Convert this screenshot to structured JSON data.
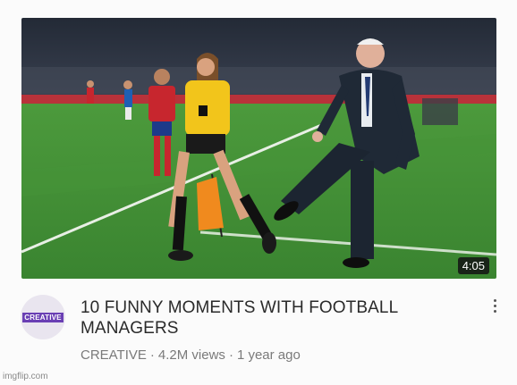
{
  "video": {
    "duration": "4:05",
    "title": "10 FUNNY MOMENTS WITH FOOTBALL MANAGERS",
    "channel": "CREATIVE",
    "views": "4.2M views",
    "separator": "·",
    "age": "1 year ago",
    "avatar_text": "CREATIVE",
    "thumbnail_icon": "video-thumbnail"
  },
  "icons": {
    "menu": "more-vert-icon"
  },
  "watermark": "imgflip.com",
  "colors": {
    "pitch": "#3f8b36",
    "stands": "#2a3140",
    "referee_shirt": "#f2c51b",
    "avatar_accent": "#6a3fb4"
  }
}
